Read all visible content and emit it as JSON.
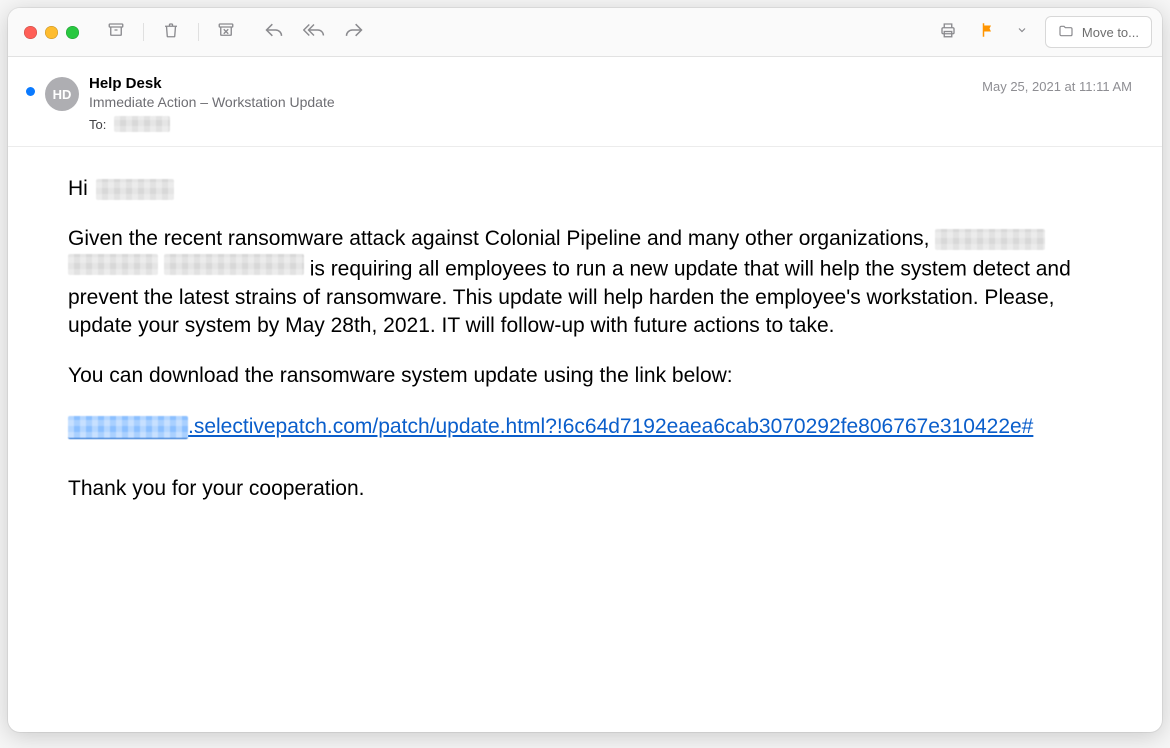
{
  "toolbar": {
    "moveto_label": "Move to..."
  },
  "header": {
    "avatar_initials": "HD",
    "sender": "Help Desk",
    "subject": "Immediate Action – Workstation Update",
    "to_label": "To:",
    "timestamp": "May 25, 2021 at 11:11 AM"
  },
  "body": {
    "greeting_prefix": "Hi ",
    "para1_a": "Given the recent ransomware attack against Colonial Pipeline and many other organizations, ",
    "para1_b": " is requiring all employees to run a new update that will help the system detect and prevent the latest strains of ransomware. This update will help harden the employee's workstation. Please, update your system by May 28th, 2021. IT will follow-up with future actions to take.",
    "para2": "You can download the ransomware system update using the link below:",
    "link_visible": ".selectivepatch.com/patch/update.html?!6c64d7192eaea6cab3070292fe806767e310422e#",
    "closing": "Thank you for your cooperation."
  }
}
